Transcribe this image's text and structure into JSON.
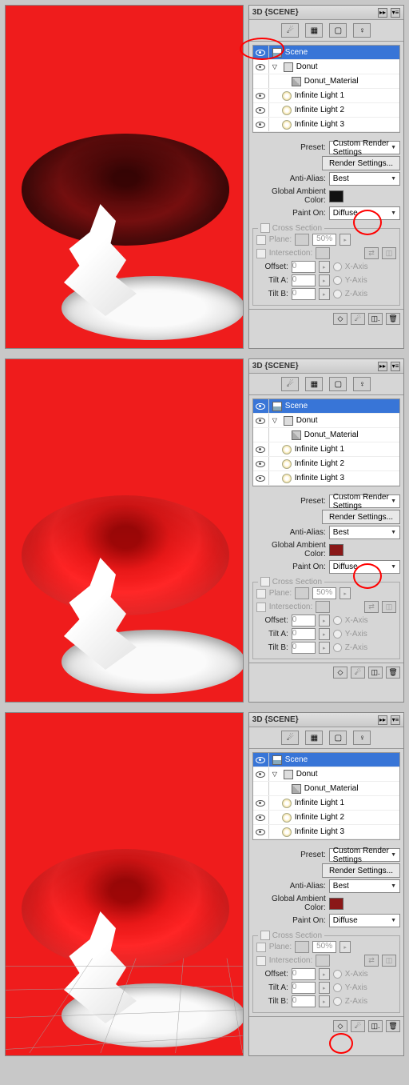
{
  "panel_title": "3D {SCENE}",
  "tree": {
    "scene": "Scene",
    "donut": "Donut",
    "material": "Donut_Material",
    "light1": "Infinite Light 1",
    "light2": "Infinite Light 2",
    "light3": "Infinite Light 3"
  },
  "props": {
    "preset_lbl": "Preset:",
    "preset_val": "Custom Render Settings",
    "render_btn": "Render Settings...",
    "aa_lbl": "Anti-Alias:",
    "aa_val": "Best",
    "gac_lbl": "Global Ambient Color:",
    "paint_lbl": "Paint On:",
    "paint_val": "Diffuse"
  },
  "cross": {
    "title": "Cross Section",
    "plane": "Plane:",
    "pct": "50%",
    "intersection": "Intersection:",
    "offset": "Offset:",
    "offset_v": "0",
    "tilta": "Tilt A:",
    "tilta_v": "0",
    "tiltb": "Tilt B:",
    "tiltb_v": "0",
    "xaxis": "X-Axis",
    "yaxis": "Y-Axis",
    "zaxis": "Z-Axis"
  },
  "colors": {
    "block1_gac": "#111111",
    "block2_gac": "#8a1818",
    "block3_gac": "#8a1818"
  }
}
